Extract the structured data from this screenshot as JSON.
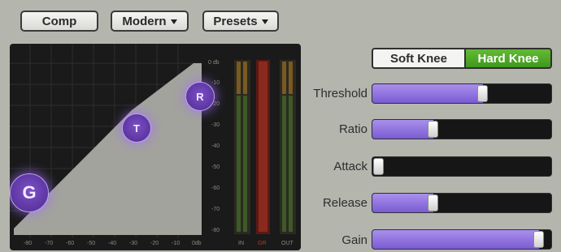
{
  "toolbar": {
    "comp_label": "Comp",
    "mode_label": "Modern",
    "presets_label": "Presets"
  },
  "graph": {
    "db_scale": [
      "0 db",
      "-10",
      "-20",
      "-30",
      "-40",
      "-50",
      "-60",
      "-70",
      "-80"
    ],
    "x_axis": [
      "-80",
      "-70",
      "-60",
      "-50",
      "-40",
      "-30",
      "-20",
      "-10",
      "0db"
    ],
    "meter_labels": [
      "IN",
      "GR",
      "OUT"
    ],
    "knobs": {
      "gain": "G",
      "threshold": "T",
      "ratio": "R"
    }
  },
  "knee": {
    "soft_label": "Soft Knee",
    "hard_label": "Hard Knee",
    "selected": "hard"
  },
  "controls": [
    {
      "label": "Threshold",
      "value": 0.62
    },
    {
      "label": "Ratio",
      "value": 0.34
    },
    {
      "label": "Attack",
      "value": 0.0
    },
    {
      "label": "Release",
      "value": 0.34
    },
    {
      "label": "Gain",
      "value": 0.93
    }
  ],
  "colors": {
    "accent": "#7a5bd3",
    "hard_knee_active": "#4faa2a",
    "background": "#b4b6ae"
  }
}
